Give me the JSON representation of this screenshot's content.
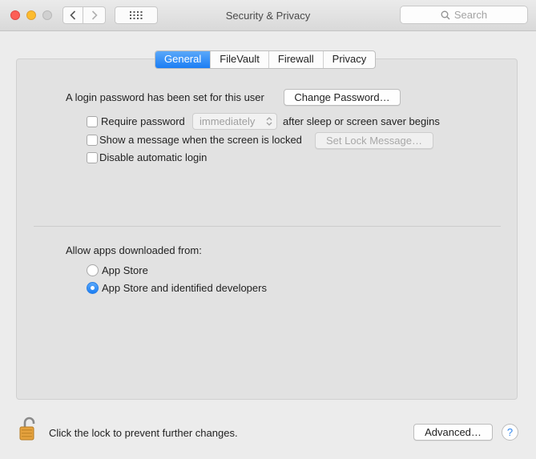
{
  "window": {
    "title": "Security & Privacy"
  },
  "toolbar": {
    "search_placeholder": "Search"
  },
  "tabs": [
    {
      "label": "General",
      "active": true
    },
    {
      "label": "FileVault",
      "active": false
    },
    {
      "label": "Firewall",
      "active": false
    },
    {
      "label": "Privacy",
      "active": false
    }
  ],
  "general": {
    "login_password_text": "A login password has been set for this user",
    "change_password_label": "Change Password…",
    "require_password_label": "Require password",
    "require_password_checked": false,
    "require_password_delay": "immediately",
    "require_password_suffix": "after sleep or screen saver begins",
    "show_message_label": "Show a message when the screen is locked",
    "show_message_checked": false,
    "set_lock_message_label": "Set Lock Message…",
    "disable_auto_login_label": "Disable automatic login",
    "disable_auto_login_checked": false
  },
  "downloads": {
    "heading": "Allow apps downloaded from:",
    "options": [
      {
        "label": "App Store",
        "selected": false
      },
      {
        "label": "App Store and identified developers",
        "selected": true
      }
    ]
  },
  "footer": {
    "lock_text": "Click the lock to prevent further changes.",
    "advanced_label": "Advanced…",
    "help_label": "?"
  },
  "colors": {
    "accent": "#1b7ef4",
    "close": "#fc5f57",
    "minimize": "#fdbc2e"
  }
}
